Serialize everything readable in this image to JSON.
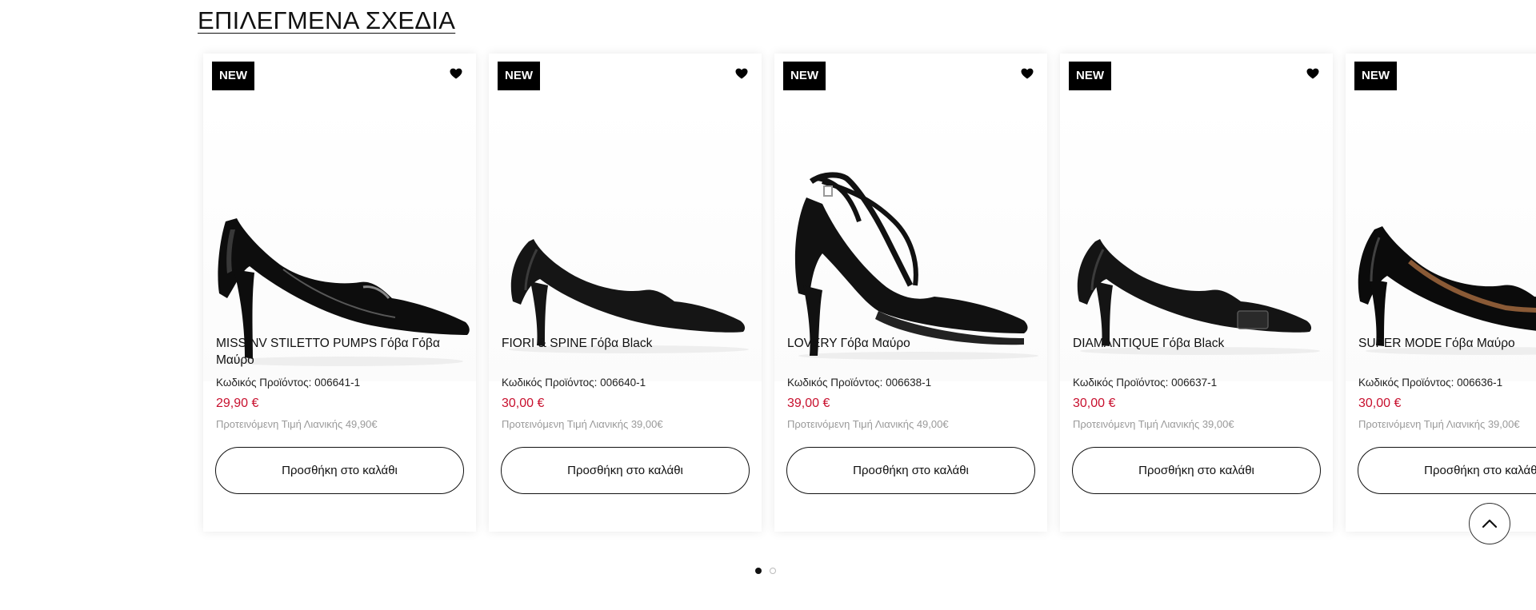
{
  "section": {
    "title": "ΕΠΙΛΕΓΜΕΝΑ ΣΧΕΔΙΑ"
  },
  "products": [
    {
      "badge": "NEW",
      "name": "MISS  NV STILETTO  PUMPS Γόβα Γόβα Μαύρο",
      "code": "Κωδικός Προϊόντος: 006641-1",
      "price": "29,90 €",
      "rrp": "Προτεινόμενη Τιμή Λιανικής 49,90€",
      "button": "Προσθήκη στο καλάθι",
      "image_icon": "patent-pump-shoe-icon"
    },
    {
      "badge": "NEW",
      "name": "FIORI & SPINE Γόβα Black",
      "code": "Κωδικός Προϊόντος: 006640-1",
      "price": "30,00 €",
      "rrp": "Προτεινόμενη Τιμή Λιανικής 39,00€",
      "button": "Προσθήκη στο καλάθι",
      "image_icon": "pump-shoe-icon"
    },
    {
      "badge": "NEW",
      "name": "LOVERY Γόβα Μαύρο",
      "code": "Κωδικός Προϊόντος: 006638-1",
      "price": "39,00 €",
      "rrp": "Προτεινόμενη Τιμή Λιανικής 49,00€",
      "button": "Προσθήκη στο καλάθι",
      "image_icon": "strappy-heel-shoe-icon"
    },
    {
      "badge": "NEW",
      "name": "DIAMANTIQUE Γόβα Black",
      "code": "Κωδικός Προϊόντος: 006637-1",
      "price": "30,00 €",
      "rrp": "Προτεινόμενη Τιμή Λιανικής 39,00€",
      "button": "Προσθήκη στο καλάθι",
      "image_icon": "buckle-pump-shoe-icon"
    },
    {
      "badge": "NEW",
      "name": "SUPER  MODE Γόβα Μαύρο",
      "code": "Κωδικός Προϊόντος: 006636-1",
      "price": "30,00 €",
      "rrp": "Προτεινόμενη Τιμή Λιανικής 39,00€",
      "button": "Προσθήκη στο καλάθι",
      "image_icon": "patent-pump-shoe-icon"
    }
  ],
  "pagination": {
    "pages": 2,
    "active": 1
  },
  "colors": {
    "price": "#c8102e",
    "badge_bg": "#000000",
    "badge_text": "#ffffff"
  },
  "scroll_top_icon": "chevron-up-icon",
  "favorite_icon": "heart-icon"
}
